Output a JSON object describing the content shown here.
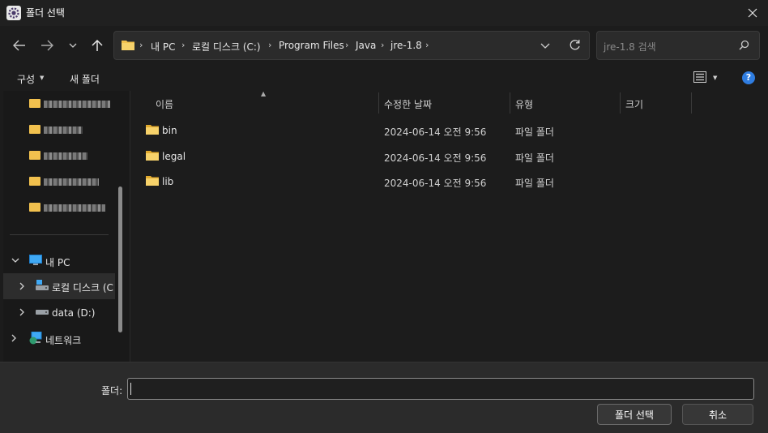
{
  "window": {
    "title": "폴더 선택",
    "close_icon": "close-icon",
    "app_icon": "settings-gear-icon"
  },
  "nav": {
    "back_icon": "back-arrow-icon",
    "forward_icon": "forward-arrow-icon",
    "recent_icon": "chevron-down-icon",
    "up_icon": "up-arrow-icon"
  },
  "address": {
    "crumbs": [
      "내 PC",
      "로컬 디스크 (C:)",
      "Program Files",
      "Java",
      "jre-1.8"
    ],
    "separator": "›",
    "dropdown_icon": "chevron-down-icon",
    "refresh_icon": "refresh-icon"
  },
  "search": {
    "placeholder": "jre-1.8 검색",
    "icon": "search-icon"
  },
  "toolbar": {
    "organize_label": "구성",
    "new_folder_label": "새 폴더",
    "view_icon": "details-view-icon",
    "help_label": "?"
  },
  "navpane": {
    "this_pc_label": "내 PC",
    "local_disk_label": "로컬 디스크 (C",
    "data_label": "data (D:)",
    "network_label": "네트워크"
  },
  "filelist": {
    "columns": [
      "이름",
      "수정한 날짜",
      "유형",
      "크기"
    ],
    "rows": [
      {
        "name": "bin",
        "date": "2024-06-14 오전 9:56",
        "type": "파일 폴더"
      },
      {
        "name": "legal",
        "date": "2024-06-14 오전 9:56",
        "type": "파일 폴더"
      },
      {
        "name": "lib",
        "date": "2024-06-14 오전 9:56",
        "type": "파일 폴더"
      }
    ]
  },
  "footer": {
    "folder_label": "폴더:",
    "folder_value": "",
    "select_label": "폴더 선택",
    "cancel_label": "취소"
  },
  "colors": {
    "folder_yellow": "#f2c14e",
    "help_blue": "#2f7de1",
    "background": "#1c1c1c"
  }
}
